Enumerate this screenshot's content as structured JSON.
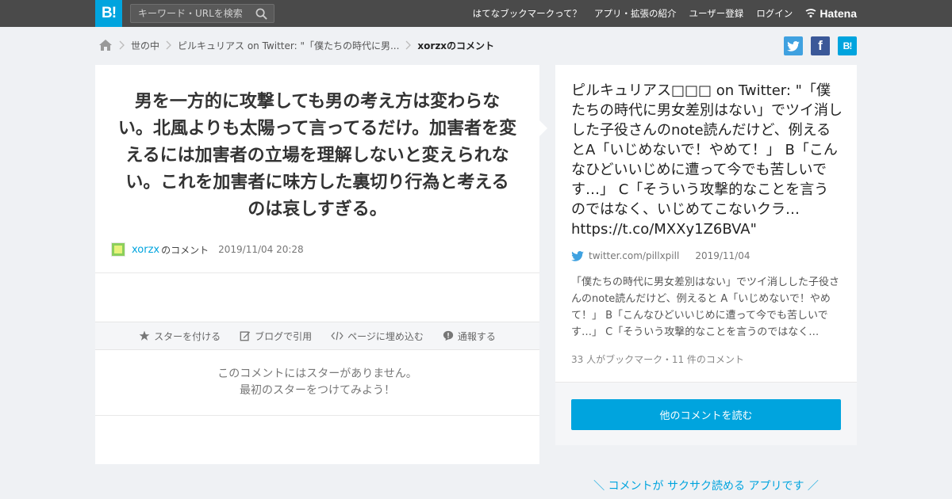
{
  "header": {
    "logo": "B!",
    "search_placeholder": "キーワード・URLを検索",
    "nav": [
      "はてなブックマークって？",
      "アプリ・拡張の紹介",
      "ユーザー登録",
      "ログイン"
    ],
    "brand": "Hatena"
  },
  "breadcrumb": {
    "items": [
      "世の中",
      "ピルキュリアス on Twitter: \"「僕たちの時代に男...",
      "xorzxのコメント"
    ]
  },
  "share": {
    "facebook": "f",
    "hatena": "B!"
  },
  "comment": {
    "text": "男を一方的に攻撃しても男の考え方は変わらない。北風よりも太陽って言ってるだけ。加害者を変えるには加害者の立場を理解しないと変えられない。これを加害者に味方した裏切り行為と考えるのは哀しすぎる。",
    "user": "xorzx",
    "user_suffix": "のコメント",
    "date": "2019/11/04 20:28"
  },
  "actions": [
    "スターを付ける",
    "ブログで引用",
    "ページに埋め込む",
    "通報する"
  ],
  "no_stars": [
    "このコメントにはスターがありません。",
    "最初のスターをつけてみよう！"
  ],
  "entry": {
    "title": "ピルキュリアス□□□ on Twitter: \"「僕たちの時代に男女差別はない」でツイ消しした子役さんのnote読んだけど、例えるとA「いじめないで！やめて！」 B「こんなひどいいじめに遭って今でも苦しいです…」 C「そういう攻撃的なことを言うのではなく、いじめてこないクラ… https://t.co/MXXy1Z6BVA\"",
    "source": "twitter.com/pillxpill",
    "date": "2019/11/04",
    "summary": "「僕たちの時代に男女差別はない」でツイ消しした子役さんのnote読んだけど、例えると A「いじめないで！やめて！」 B「こんなひどいいじめに遭って今でも苦しいです…」 C「そういう攻撃的なことを言うのではなく…",
    "counts": "33 人がブックマーク・11 件のコメント",
    "more_button": "他のコメントを読む"
  },
  "app_promo": "＼ コメントが サクサク読める アプリです ／"
}
